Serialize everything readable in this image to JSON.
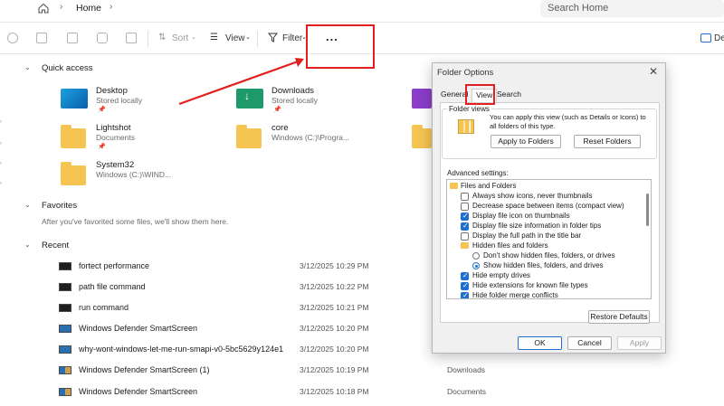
{
  "address_bar": {
    "breadcrumb_home": "Home",
    "search_placeholder": "Search Home"
  },
  "toolbar": {
    "sort_label": "Sort",
    "view_label": "View",
    "filter_label": "Filter",
    "more_label": "...",
    "details_label": "De"
  },
  "sections": {
    "quick_access": "Quick access",
    "favorites": "Favorites",
    "favorites_empty": "After you've favorited some files, we'll show them here.",
    "recent": "Recent"
  },
  "quick_access_items": [
    {
      "name": "Desktop",
      "sub": "Stored locally"
    },
    {
      "name": "Downloads",
      "sub": "Stored locally"
    },
    {
      "name": "Lightshot",
      "sub": "Documents"
    },
    {
      "name": "core",
      "sub": "Windows (C:)\\Progra..."
    },
    {
      "name": "System32",
      "sub": "Windows (C:)\\WIND..."
    }
  ],
  "recent_items": [
    {
      "name": "fortect performance",
      "date": "3/12/2025 10:29 PM",
      "location": ""
    },
    {
      "name": "path file command",
      "date": "3/12/2025 10:22 PM",
      "location": ""
    },
    {
      "name": "run command",
      "date": "3/12/2025 10:21 PM",
      "location": ""
    },
    {
      "name": "Windows Defender SmartScreen",
      "date": "3/12/2025 10:20 PM",
      "location": ""
    },
    {
      "name": "why-wont-windows-let-me-run-smapi-v0-5bc5629y124e1",
      "date": "3/12/2025 10:20 PM",
      "location": ""
    },
    {
      "name": "Windows Defender SmartScreen (1)",
      "date": "3/12/2025 10:19 PM",
      "location": "Downloads"
    },
    {
      "name": "Windows Defender SmartScreen",
      "date": "3/12/2025 10:18 PM",
      "location": "Documents"
    }
  ],
  "dialog": {
    "title": "Folder Options",
    "tabs": [
      "General",
      "View",
      "Search"
    ],
    "folder_views_label": "Folder views",
    "folder_views_text": "You can apply this view (such as Details or Icons) to all folders of this type.",
    "apply_to_folders": "Apply to Folders",
    "reset_folders": "Reset Folders",
    "advanced_label": "Advanced settings:",
    "tree": {
      "root": "Files and Folders",
      "items": [
        {
          "label": "Always show icons, never thumbnails",
          "checked": false
        },
        {
          "label": "Decrease space between items (compact view)",
          "checked": false
        },
        {
          "label": "Display file icon on thumbnails",
          "checked": true
        },
        {
          "label": "Display file size information in folder tips",
          "checked": true
        },
        {
          "label": "Display the full path in the title bar",
          "checked": false
        }
      ],
      "hidden_group": "Hidden files and folders",
      "hidden_options": [
        {
          "label": "Don't show hidden files, folders, or drives",
          "selected": false
        },
        {
          "label": "Show hidden files, folders, and drives",
          "selected": true
        }
      ],
      "more_items": [
        {
          "label": "Hide empty drives",
          "checked": true
        },
        {
          "label": "Hide extensions for known file types",
          "checked": true
        },
        {
          "label": "Hide folder merge conflicts",
          "checked": true
        }
      ]
    },
    "restore_defaults": "Restore Defaults",
    "ok": "OK",
    "cancel": "Cancel",
    "apply": "Apply"
  },
  "colors": {
    "highlight": "#e02020",
    "folder": "#f5c451",
    "checkbox": "#1f6fd0"
  }
}
